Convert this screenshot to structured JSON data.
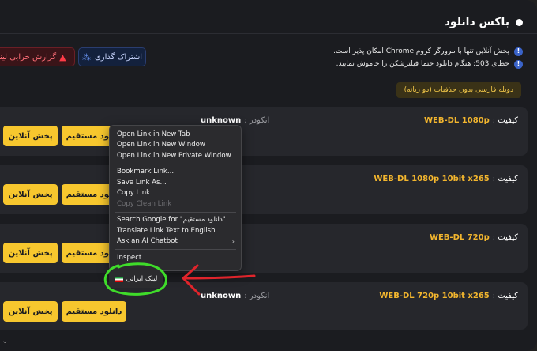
{
  "header": {
    "title": "باکس دانلود"
  },
  "notes": [
    "پخش آنلاین تنها با مرورگر کروم Chrome امکان پذیر است.",
    "خطای 503: هنگام دانلود حتما فیلترشکن را خاموش نمایید."
  ],
  "buttons": {
    "share": "اشتراک گذاری",
    "report": "گزارش خرابی لینک"
  },
  "tag": "دوبله فارسی بدون حذفیات (دو زبانه)",
  "labels": {
    "quality": "کیفیت :",
    "encoder": "انکودر :",
    "play": "پخش آنلاین",
    "download": "دانلود مستقیم"
  },
  "rows": [
    {
      "quality": "WEB-DL 1080p",
      "encoder": "unknown"
    },
    {
      "quality": "WEB-DL 1080p 10bit x265",
      "encoder": ""
    },
    {
      "quality": "WEB-DL 720p",
      "encoder": ""
    },
    {
      "quality": "WEB-DL 720p 10bit x265",
      "encoder": "unknown"
    }
  ],
  "context_menu": {
    "items": [
      "Open Link in New Tab",
      "Open Link in New Window",
      "Open Link in New Private Window",
      "Bookmark Link...",
      "Save Link As...",
      "Copy Link",
      "Copy Clean Link",
      "Search Google for \"دانلود مستقیم\"",
      "Translate Link Text to English",
      "Ask an AI Chatbot",
      "Inspect"
    ],
    "extension_item": "لینک ایرانی"
  },
  "colors": {
    "accent": "#f7c72e",
    "background": "#1b1c20",
    "card": "#26272c",
    "annotation": "#3fdc2a",
    "arrow": "#e0242b"
  },
  "icons": [
    "info-icon",
    "share-icon",
    "warning-icon",
    "submenu-chevron-icon",
    "iran-flag-icon",
    "chevron-down-icon"
  ]
}
